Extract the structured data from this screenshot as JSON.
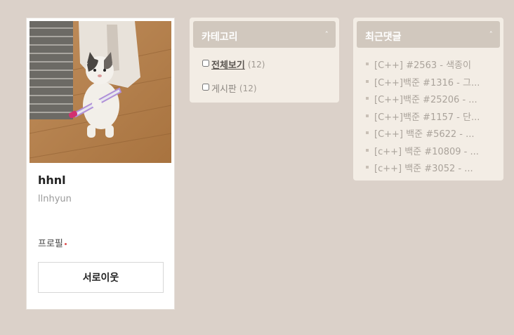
{
  "profile": {
    "name": "hhnl",
    "id": "llnhyun",
    "profile_link": "프로필",
    "neighbor_button": "서로이웃"
  },
  "categories": {
    "title": "카테고리",
    "items": [
      {
        "label": "전체보기",
        "count": "(12)"
      },
      {
        "label": "게시판",
        "count": "(12)"
      }
    ]
  },
  "recent_comments": {
    "title": "최근댓글",
    "items": [
      "[C++] #2563 - 색종이",
      "[C++]백준 #1316 - 그...",
      "[C++]백준 #25206 - ...",
      "[C++]백준 #1157 - 단...",
      "[C++] 백준 #5622 - ...",
      "[c++] 백준 #10809 - ...",
      "[c++] 백준 #3052 - ..."
    ]
  },
  "icons": {
    "collapse": "chevron-up-icon",
    "checkbox": "checkbox-icon"
  },
  "colors": {
    "background": "#dbd1c9",
    "widget": "#f3ede5",
    "widget_header": "#d1c8be",
    "profile_dot": "#e05050"
  }
}
